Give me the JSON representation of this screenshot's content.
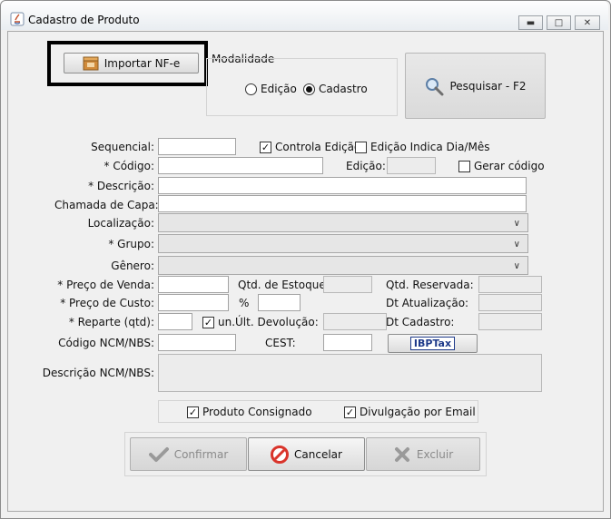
{
  "window": {
    "title": "Cadastro de Produto",
    "controls": [
      "minimize-icon",
      "maximize-icon",
      "close-icon"
    ]
  },
  "toolbar": {
    "import_label": "Importar NF-e",
    "search_label": "Pesquisar - F2"
  },
  "modalidade": {
    "title": "Modalidade",
    "options": [
      {
        "label": "Edição",
        "selected": false
      },
      {
        "label": "Cadastro",
        "selected": true
      }
    ]
  },
  "form": {
    "sequencial_label": "Sequencial:",
    "controla_edicao": {
      "label": "Controla Edição",
      "checked": true
    },
    "edicao_indica": {
      "label": "Edição Indica Dia/Mês",
      "checked": false
    },
    "codigo_label": "Código:",
    "edicao_label": "Edição:",
    "gerar_codigo": {
      "label": "Gerar código",
      "checked": false
    },
    "descricao_label": "Descrição:",
    "chamada_label": "Chamada de Capa:",
    "localizacao_label": "Localização:",
    "grupo_label": "Grupo:",
    "genero_label": "Gênero:",
    "preco_venda_label": "Preço de Venda:",
    "qtd_estoque_label": "Qtd. de Estoque:",
    "qtd_reservada_label": "Qtd. Reservada:",
    "preco_custo_label": "Preço de Custo:",
    "percent_label": "%",
    "dt_atualizacao_label": "Dt Atualização:",
    "reparte_label": "Reparte (qtd):",
    "un": {
      "label": "un.",
      "checked": true
    },
    "ult_devolucao_label": "Últ. Devolução:",
    "dt_cadastro_label": "Dt Cadastro:",
    "ncm_label": "Código NCM/NBS:",
    "cest_label": "CEST:",
    "ibptax_label": "IBPTax",
    "desc_ncm_label": "Descrição NCM/NBS:",
    "required_mark": "*"
  },
  "options": {
    "produto_consignado": {
      "label": "Produto Consignado",
      "checked": true
    },
    "divulgacao_email": {
      "label": "Divulgação por Email",
      "checked": true
    }
  },
  "actions": {
    "confirmar": "Confirmar",
    "cancelar": "Cancelar",
    "excluir": "Excluir"
  },
  "colors": {
    "focus_border": "#000000",
    "window_bg": "#f0f0f0",
    "cancel_red": "#d9342b",
    "check_gray": "#9a9a9a"
  }
}
